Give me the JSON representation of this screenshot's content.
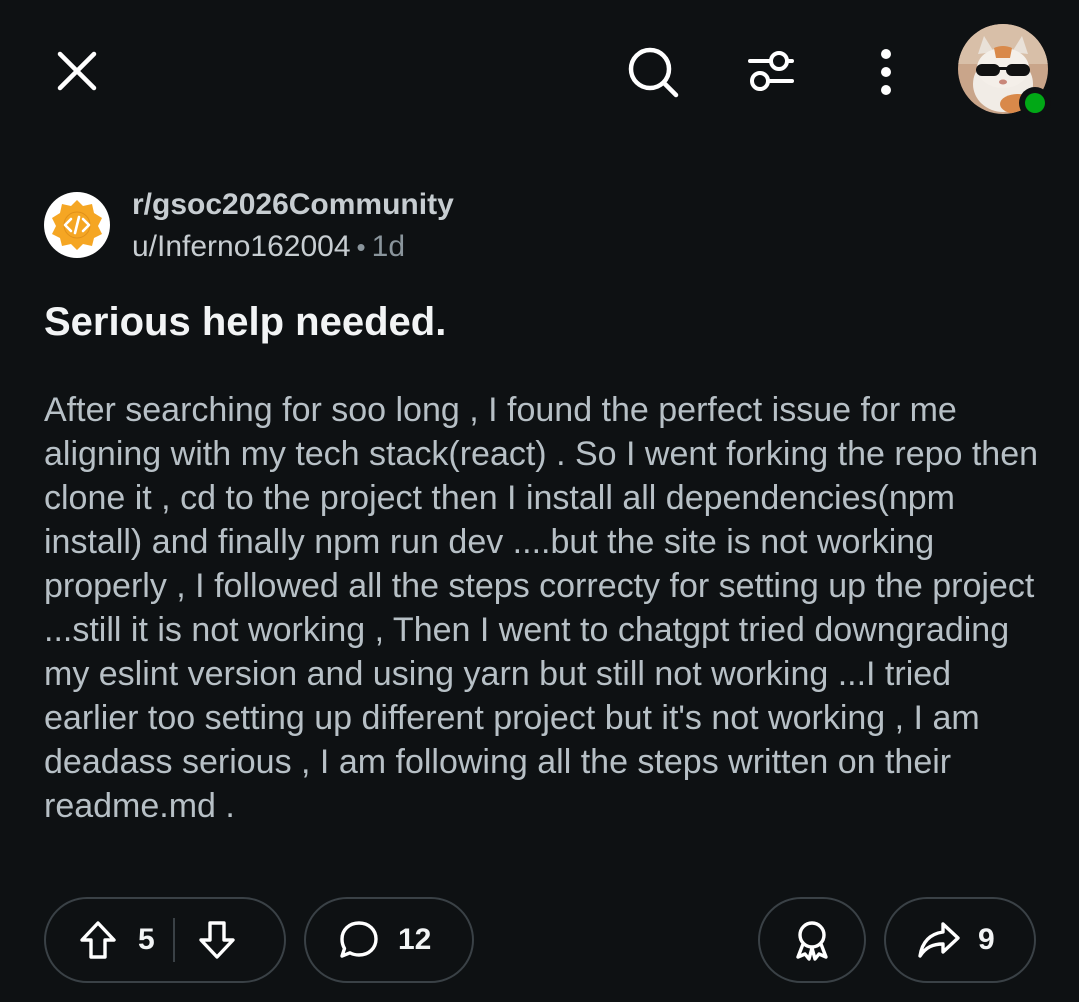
{
  "topbar": {
    "icons": [
      "close-icon",
      "search-icon",
      "filter-icon",
      "more-vertical-icon",
      "user-avatar"
    ],
    "online_status_color": "#01a816"
  },
  "post": {
    "subreddit": "r/gsoc2026Community",
    "author": "u/Inferno162004",
    "separator": "•",
    "age": "1d",
    "title": "Serious help needed.",
    "body": "After searching for soo long , I found the perfect issue for me aligning with my tech stack(react) . So I went forking the repo then clone it , cd to the project then I install all dependencies(npm install) and finally npm run dev ....but the site is not working properly , I followed all the steps correcty for setting up the project ...still it is not working , Then I went to chatgpt tried downgrading my eslint version and using yarn but still not working ...I tried earlier too setting up different project but it's not working , I am deadass serious , I am following all the steps written on their readme.md ."
  },
  "actions": {
    "upvotes": "5",
    "comments": "12",
    "shares": "9"
  },
  "colors": {
    "background": "#0e1113",
    "text_primary": "#f2f4f5",
    "text_body": "#b7c0c6",
    "subreddit_icon": "#f5a623",
    "pill_border": "#3a4146"
  }
}
